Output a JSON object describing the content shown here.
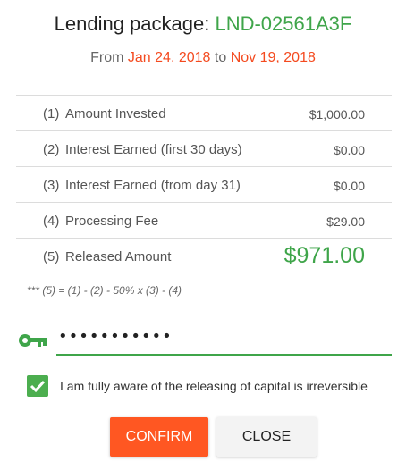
{
  "header": {
    "title_prefix": "Lending package:",
    "package_code": "LND-02561A3F",
    "from_label": "From",
    "from_date": "Jan 24, 2018",
    "to_label": "to",
    "to_date": "Nov 19, 2018"
  },
  "summary": {
    "rows": [
      {
        "num": "(1)",
        "label": "Amount Invested",
        "value": "$1,000.00"
      },
      {
        "num": "(2)",
        "label": "Interest Earned (first 30 days)",
        "value": "$0.00"
      },
      {
        "num": "(3)",
        "label": "Interest Earned (from day 31)",
        "value": "$0.00"
      },
      {
        "num": "(4)",
        "label": "Processing Fee",
        "value": "$29.00"
      },
      {
        "num": "(5)",
        "label": "Released Amount",
        "value": "$971.00"
      }
    ],
    "formula": "*** (5) = (1) - (2) - 50% x (3) - (4)"
  },
  "password": {
    "value": "•••••••••••",
    "icon": "key-icon"
  },
  "acknowledgement": {
    "checked": true,
    "label": "I am fully aware of the releasing of capital is irreversible"
  },
  "actions": {
    "confirm_label": "CONFIRM",
    "close_label": "CLOSE"
  },
  "colors": {
    "accent_green": "#3fa54a",
    "date_orange": "#f44a1f",
    "confirm_orange": "#ff5722",
    "checkbox_green": "#4cae4f"
  }
}
